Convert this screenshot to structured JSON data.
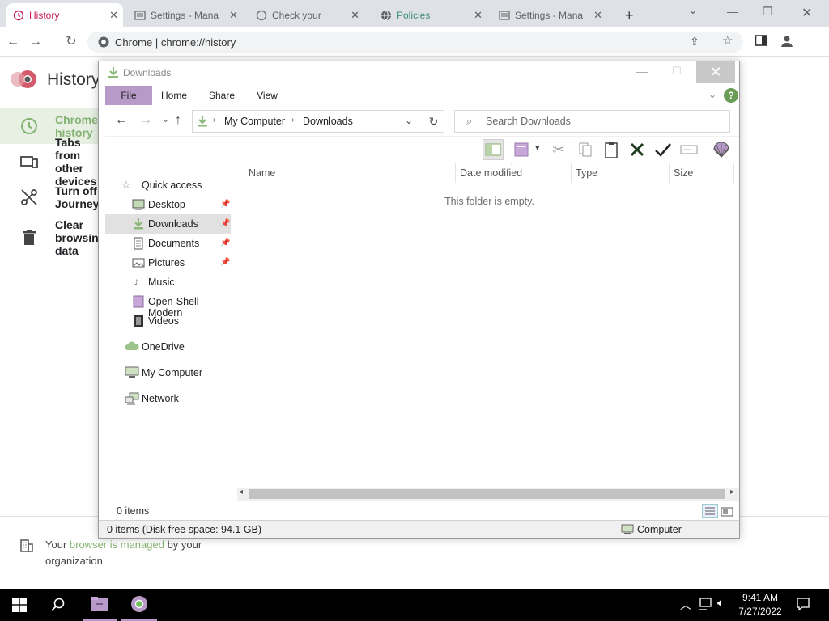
{
  "chrome": {
    "tabs": [
      {
        "label": "History",
        "active": true
      },
      {
        "label": "Settings - Mana",
        "active": false
      },
      {
        "label": "Check your",
        "active": false
      },
      {
        "label": "Policies",
        "active": false
      },
      {
        "label": "Settings - Mana",
        "active": false
      }
    ],
    "new_tab_glyph": "+",
    "url": "Chrome  |  chrome://history"
  },
  "history_page": {
    "title": "History",
    "items": [
      {
        "label": "Chrome history",
        "icon": "clock-icon"
      },
      {
        "label": "Tabs from other devices",
        "icon": "devices-icon"
      },
      {
        "label": "Turn off Journeys",
        "icon": "journeys-off-icon"
      },
      {
        "label": "Clear browsing data",
        "icon": "trash-icon"
      }
    ],
    "managed_prefix": "Your ",
    "managed_link": "browser is managed",
    "managed_suffix": " by your organization"
  },
  "explorer": {
    "title": "Downloads",
    "ribbon_tabs": [
      "File",
      "Home",
      "Share",
      "View"
    ],
    "address": {
      "root": "My Computer",
      "current": "Downloads"
    },
    "search_placeholder": "Search Downloads",
    "nav": [
      {
        "label": "Quick access",
        "icon": "star-icon",
        "pinned": false,
        "indent": 0
      },
      {
        "label": "Desktop",
        "icon": "desktop-icon",
        "pinned": true,
        "indent": 1
      },
      {
        "label": "Downloads",
        "icon": "download-arrow-icon",
        "pinned": true,
        "indent": 1,
        "selected": true
      },
      {
        "label": "Documents",
        "icon": "document-icon",
        "pinned": true,
        "indent": 1
      },
      {
        "label": "Pictures",
        "icon": "pictures-icon",
        "pinned": true,
        "indent": 1
      },
      {
        "label": "Music",
        "icon": "music-icon",
        "pinned": false,
        "indent": 1
      },
      {
        "label": "Open-Shell Modern",
        "icon": "folder-icon",
        "pinned": false,
        "indent": 1
      },
      {
        "label": "Videos",
        "icon": "videos-icon",
        "pinned": false,
        "indent": 1
      },
      {
        "label": "OneDrive",
        "icon": "cloud-icon",
        "pinned": false,
        "indent": 0
      },
      {
        "label": "My Computer",
        "icon": "computer-icon",
        "pinned": false,
        "indent": 0
      },
      {
        "label": "Network",
        "icon": "network-icon",
        "pinned": false,
        "indent": 0
      }
    ],
    "columns": [
      "Name",
      "Date modified",
      "Type",
      "Size"
    ],
    "empty_message": "This folder is empty.",
    "item_count": "0 items",
    "status_detail": "0 items (Disk free space: 94.1 GB)",
    "status_location": "Computer"
  },
  "taskbar": {
    "time": "9:41 AM",
    "date": "7/27/2022"
  },
  "colors": {
    "accent_green": "#84b371",
    "file_tab": "#b89ac8",
    "tab_active_text": "#c2185b"
  }
}
